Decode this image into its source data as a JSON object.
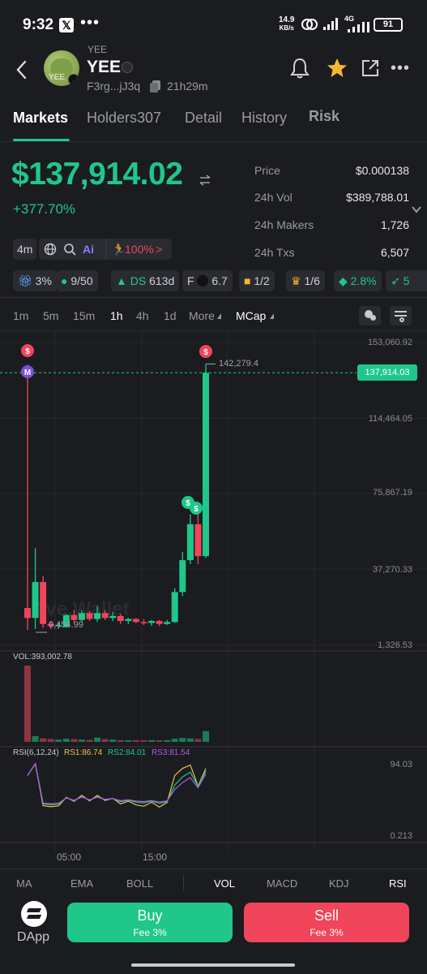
{
  "status_bar": {
    "time": "9:32",
    "x_badge": "𝕏",
    "more": "•••",
    "net_speed_value": "14.9",
    "net_speed_unit": "KB/s",
    "network": "4G",
    "battery": "91"
  },
  "header": {
    "token_small_name": "YEE",
    "token_name": "YEE",
    "address": "F3rg...jJ3q",
    "age": "21h29m"
  },
  "tabs": [
    {
      "label": "Markets",
      "active": true
    },
    {
      "label": "Holders307",
      "active": false
    },
    {
      "label": "Detail",
      "active": false
    },
    {
      "label": "History",
      "active": false
    },
    {
      "label": "Risk",
      "active": false
    }
  ],
  "summary": {
    "market_cap": "$137,914.02",
    "change": "+377.70%",
    "stats": [
      {
        "label": "Price",
        "value": "$0.000138"
      },
      {
        "label": "24h Vol",
        "value": "$389,788.01"
      },
      {
        "label": "24h Makers",
        "value": "1,726"
      },
      {
        "label": "24h Txs",
        "value": "6,507"
      }
    ]
  },
  "chips_row1": {
    "age": "4m",
    "ai": "Ai",
    "runner": "100%",
    "chevron": ">"
  },
  "chips_row2": [
    {
      "icon": "gift-icon",
      "value": "3%"
    },
    {
      "icon": "person-icon",
      "value": "9/50"
    },
    {
      "icon": "hat-icon",
      "prefix": "DS",
      "value": "613d"
    },
    {
      "icon": "solana-icon",
      "prefix": "F",
      "value": "6.7"
    },
    {
      "icon": "money-bag-icon",
      "value": "1/2"
    },
    {
      "icon": "trophy-icon",
      "value": "1/6"
    },
    {
      "icon": "frog-icon",
      "value": "2.8%"
    },
    {
      "icon": "rocket-icon",
      "value": "5"
    }
  ],
  "timeframes": [
    {
      "label": "1m",
      "active": false
    },
    {
      "label": "5m",
      "active": false
    },
    {
      "label": "15m",
      "active": false
    },
    {
      "label": "1h",
      "active": true
    },
    {
      "label": "4h",
      "active": false
    },
    {
      "label": "1d",
      "active": false
    }
  ],
  "more_label": "More",
  "mcap_label": "MCap",
  "chart_data": {
    "type": "candlestick",
    "y_axis_labels": [
      "153,060.92",
      "114,464.05",
      "75,867.19",
      "37,270.33",
      "1,326.53"
    ],
    "current_price_tag": "137,914.03",
    "high_label": "142,279.4",
    "low_label": "9,454.99",
    "ylim": [
      1326.53,
      153060.92
    ],
    "candles": [
      {
        "o": 20000,
        "h": 142000,
        "l": 9000,
        "c": 15000
      },
      {
        "o": 15000,
        "h": 50000,
        "l": 9454.99,
        "c": 33000
      },
      {
        "o": 33000,
        "h": 36000,
        "l": 10000,
        "c": 12000
      },
      {
        "o": 12000,
        "h": 13500,
        "l": 9500,
        "c": 11000
      },
      {
        "o": 11000,
        "h": 13000,
        "l": 9500,
        "c": 11500
      },
      {
        "o": 10500,
        "h": 17000,
        "l": 10000,
        "c": 16500
      },
      {
        "o": 16500,
        "h": 19000,
        "l": 13000,
        "c": 14000
      },
      {
        "o": 14000,
        "h": 19000,
        "l": 13000,
        "c": 17500
      },
      {
        "o": 17500,
        "h": 18500,
        "l": 13500,
        "c": 14500
      },
      {
        "o": 14500,
        "h": 21000,
        "l": 13000,
        "c": 17500
      },
      {
        "o": 17500,
        "h": 19000,
        "l": 14000,
        "c": 15000
      },
      {
        "o": 15000,
        "h": 18000,
        "l": 13500,
        "c": 16000
      },
      {
        "o": 16000,
        "h": 17000,
        "l": 12000,
        "c": 13500
      },
      {
        "o": 13500,
        "h": 15000,
        "l": 12000,
        "c": 14500
      },
      {
        "o": 14500,
        "h": 15000,
        "l": 12500,
        "c": 13000
      },
      {
        "o": 13000,
        "h": 14500,
        "l": 11500,
        "c": 12500
      },
      {
        "o": 12500,
        "h": 14000,
        "l": 11000,
        "c": 13500
      },
      {
        "o": 13500,
        "h": 14000,
        "l": 11000,
        "c": 12000
      },
      {
        "o": 12000,
        "h": 14000,
        "l": 11500,
        "c": 13000
      },
      {
        "o": 13000,
        "h": 30000,
        "l": 12500,
        "c": 28000
      },
      {
        "o": 28000,
        "h": 48000,
        "l": 26000,
        "c": 44000
      },
      {
        "o": 44000,
        "h": 67000,
        "l": 42000,
        "c": 62000
      },
      {
        "o": 62000,
        "h": 68000,
        "l": 42000,
        "c": 46000
      },
      {
        "o": 46000,
        "h": 142279.4,
        "l": 45000,
        "c": 137914.03
      }
    ],
    "volume_label": "VOL:393,002.78",
    "volumes": [
      393002.78,
      30000,
      18000,
      15000,
      12000,
      16000,
      14000,
      12000,
      10000,
      22000,
      14000,
      12000,
      9000,
      8000,
      9000,
      7000,
      9000,
      8000,
      9000,
      16000,
      20000,
      18000,
      15000,
      55000
    ],
    "rsi_label": "RSI(6,12,24)",
    "rsi1_label": "RS1:86.74",
    "rsi2_label": "RS2:84.01",
    "rsi3_label": "RS3:81.54",
    "rsi_axis_top": "94.03",
    "rsi_axis_bottom": "0.213",
    "x_labels": [
      "05:00",
      "15:00"
    ],
    "watermark": "Ave.Wallet"
  },
  "indicators": [
    {
      "label": "MA",
      "active": false
    },
    {
      "label": "EMA",
      "active": false
    },
    {
      "label": "BOLL",
      "active": false
    },
    {
      "label": "VOL",
      "active": true
    },
    {
      "label": "MACD",
      "active": false
    },
    {
      "label": "KDJ",
      "active": false
    },
    {
      "label": "RSI",
      "active": true
    }
  ],
  "bottom": {
    "dapp_label": "DApp",
    "buy_label": "Buy",
    "buy_fee": "Fee 3%",
    "sell_label": "Sell",
    "sell_fee": "Fee 3%"
  },
  "colors": {
    "green": "#1fc78b",
    "red": "#f0455a",
    "background": "#1b1c20",
    "accent_star": "#f5b82e"
  }
}
